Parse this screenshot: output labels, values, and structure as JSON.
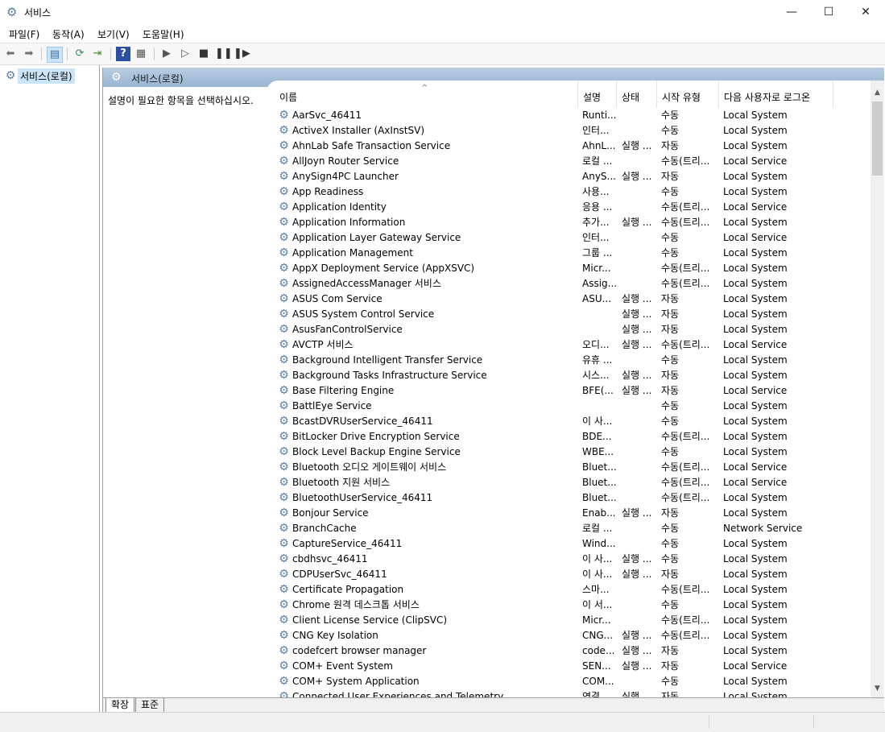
{
  "window": {
    "title": "서비스",
    "minimize": "—",
    "maximize": "☐",
    "close": "✕"
  },
  "menu": [
    "파일(F)",
    "동작(A)",
    "보기(V)",
    "도움말(H)"
  ],
  "toolbar": {
    "back": "arrow-left-icon",
    "forward": "arrow-right-icon",
    "show_hide": "console-tree-icon",
    "refresh": "refresh-icon",
    "export": "export-icon",
    "help": "help-icon",
    "properties": "properties-icon",
    "start": "play-icon",
    "start2": "play-icon",
    "stop": "stop-icon",
    "pause": "pause-icon",
    "restart": "restart-icon"
  },
  "tree": {
    "item_label": "서비스(로컬)"
  },
  "header": {
    "title": "서비스(로컬)"
  },
  "description_pane": {
    "text": "설명이 필요한 항목을 선택하십시오."
  },
  "columns": {
    "name": "이름",
    "desc": "설명",
    "status": "상태",
    "startup": "시작 유형",
    "logon": "다음 사용자로 로그온"
  },
  "sort_arrow": "^",
  "services": [
    {
      "name": "AarSvc_46411",
      "desc": "Runti...",
      "status": "",
      "startup": "수동",
      "logon": "Local System"
    },
    {
      "name": "ActiveX Installer (AxInstSV)",
      "desc": "인터...",
      "status": "",
      "startup": "수동",
      "logon": "Local System"
    },
    {
      "name": "AhnLab Safe Transaction Service",
      "desc": "AhnL...",
      "status": "실행 ...",
      "startup": "자동",
      "logon": "Local System"
    },
    {
      "name": "AllJoyn Router Service",
      "desc": "로컬 ...",
      "status": "",
      "startup": "수동(트리...",
      "logon": "Local Service"
    },
    {
      "name": "AnySign4PC Launcher",
      "desc": "AnyS...",
      "status": "실행 ...",
      "startup": "자동",
      "logon": "Local System"
    },
    {
      "name": "App Readiness",
      "desc": "사용...",
      "status": "",
      "startup": "수동",
      "logon": "Local System"
    },
    {
      "name": "Application Identity",
      "desc": "응용 ...",
      "status": "",
      "startup": "수동(트리...",
      "logon": "Local Service"
    },
    {
      "name": "Application Information",
      "desc": "추가...",
      "status": "실행 ...",
      "startup": "수동(트리...",
      "logon": "Local System"
    },
    {
      "name": "Application Layer Gateway Service",
      "desc": "인터...",
      "status": "",
      "startup": "수동",
      "logon": "Local Service"
    },
    {
      "name": "Application Management",
      "desc": "그룹 ...",
      "status": "",
      "startup": "수동",
      "logon": "Local System"
    },
    {
      "name": "AppX Deployment Service (AppXSVC)",
      "desc": "Micr...",
      "status": "",
      "startup": "수동(트리...",
      "logon": "Local System"
    },
    {
      "name": "AssignedAccessManager 서비스",
      "desc": "Assig...",
      "status": "",
      "startup": "수동(트리...",
      "logon": "Local System"
    },
    {
      "name": "ASUS Com Service",
      "desc": "ASU...",
      "status": "실행 ...",
      "startup": "자동",
      "logon": "Local System"
    },
    {
      "name": "ASUS System Control Service",
      "desc": "",
      "status": "실행 ...",
      "startup": "자동",
      "logon": "Local System"
    },
    {
      "name": "AsusFanControlService",
      "desc": "",
      "status": "실행 ...",
      "startup": "자동",
      "logon": "Local System"
    },
    {
      "name": "AVCTP 서비스",
      "desc": "오디...",
      "status": "실행 ...",
      "startup": "수동(트리...",
      "logon": "Local Service"
    },
    {
      "name": "Background Intelligent Transfer Service",
      "desc": "유휴 ...",
      "status": "",
      "startup": "수동",
      "logon": "Local System"
    },
    {
      "name": "Background Tasks Infrastructure Service",
      "desc": "시스...",
      "status": "실행 ...",
      "startup": "자동",
      "logon": "Local System"
    },
    {
      "name": "Base Filtering Engine",
      "desc": "BFE(...",
      "status": "실행 ...",
      "startup": "자동",
      "logon": "Local Service"
    },
    {
      "name": "BattlEye Service",
      "desc": "",
      "status": "",
      "startup": "수동",
      "logon": "Local System"
    },
    {
      "name": "BcastDVRUserService_46411",
      "desc": "이 사...",
      "status": "",
      "startup": "수동",
      "logon": "Local System"
    },
    {
      "name": "BitLocker Drive Encryption Service",
      "desc": "BDE...",
      "status": "",
      "startup": "수동(트리...",
      "logon": "Local System"
    },
    {
      "name": "Block Level Backup Engine Service",
      "desc": "WBE...",
      "status": "",
      "startup": "수동",
      "logon": "Local System"
    },
    {
      "name": "Bluetooth 오디오 게이트웨이 서비스",
      "desc": "Bluet...",
      "status": "",
      "startup": "수동(트리...",
      "logon": "Local Service"
    },
    {
      "name": "Bluetooth 지원 서비스",
      "desc": "Bluet...",
      "status": "",
      "startup": "수동(트리...",
      "logon": "Local Service"
    },
    {
      "name": "BluetoothUserService_46411",
      "desc": "Bluet...",
      "status": "",
      "startup": "수동(트리...",
      "logon": "Local System"
    },
    {
      "name": "Bonjour Service",
      "desc": "Enab...",
      "status": "실행 ...",
      "startup": "자동",
      "logon": "Local System"
    },
    {
      "name": "BranchCache",
      "desc": "로컬 ...",
      "status": "",
      "startup": "수동",
      "logon": "Network Service"
    },
    {
      "name": "CaptureService_46411",
      "desc": "Wind...",
      "status": "",
      "startup": "수동",
      "logon": "Local System"
    },
    {
      "name": "cbdhsvc_46411",
      "desc": "이 사...",
      "status": "실행 ...",
      "startup": "수동",
      "logon": "Local System"
    },
    {
      "name": "CDPUserSvc_46411",
      "desc": "이 사...",
      "status": "실행 ...",
      "startup": "자동",
      "logon": "Local System"
    },
    {
      "name": "Certificate Propagation",
      "desc": "스마...",
      "status": "",
      "startup": "수동(트리...",
      "logon": "Local System"
    },
    {
      "name": "Chrome 원격 데스크톱 서비스",
      "desc": "이 서...",
      "status": "",
      "startup": "수동",
      "logon": "Local System"
    },
    {
      "name": "Client License Service (ClipSVC)",
      "desc": "Micr...",
      "status": "",
      "startup": "수동(트리...",
      "logon": "Local System"
    },
    {
      "name": "CNG Key Isolation",
      "desc": "CNG...",
      "status": "실행 ...",
      "startup": "수동(트리...",
      "logon": "Local System"
    },
    {
      "name": "codefcert browser manager",
      "desc": "code...",
      "status": "실행 ...",
      "startup": "자동",
      "logon": "Local System"
    },
    {
      "name": "COM+ Event System",
      "desc": "SEN...",
      "status": "실행 ...",
      "startup": "자동",
      "logon": "Local Service"
    },
    {
      "name": "COM+ System Application",
      "desc": "COM...",
      "status": "",
      "startup": "수동",
      "logon": "Local System"
    },
    {
      "name": "Connected User Experiences and Telemetry",
      "desc": "연결...",
      "status": "실행 ...",
      "startup": "자동",
      "logon": "Local System"
    }
  ],
  "tabs": {
    "extended": "확장",
    "standard": "표준"
  }
}
